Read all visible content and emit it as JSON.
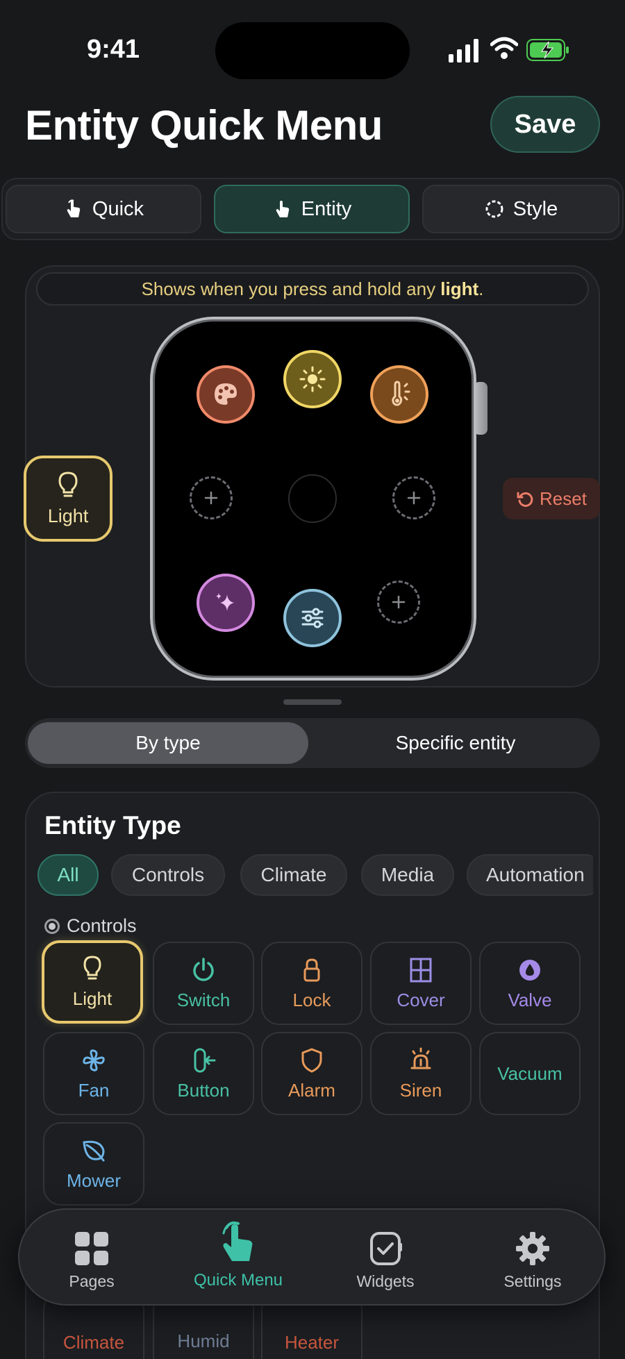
{
  "status": {
    "time": "9:41"
  },
  "header": {
    "title": "Entity Quick Menu",
    "save_label": "Save"
  },
  "tabs": [
    {
      "label": "Quick",
      "icon": "hand-tap-icon"
    },
    {
      "label": "Entity",
      "icon": "hand-pointer-icon",
      "active": true
    },
    {
      "label": "Style",
      "icon": "dashed-circle-icon"
    }
  ],
  "preview": {
    "hint_prefix": "Shows when you press and hold any ",
    "hint_bold": "light",
    "hint_suffix": ".",
    "selected_chip": "Light",
    "reset_label": "Reset",
    "slots": [
      "palette-icon",
      "brightness-icon",
      "color-temperature-icon",
      "add-slot",
      "center",
      "add-slot",
      "effects-sparkle-icon",
      "sliders-icon",
      "add-slot"
    ]
  },
  "mode": {
    "options": [
      "By type",
      "Specific entity"
    ],
    "selected": "By type"
  },
  "entity_type": {
    "title": "Entity Type",
    "filters": [
      "All",
      "Controls",
      "Climate",
      "Media",
      "Automation"
    ],
    "active_filter": "All",
    "group_label": "Controls",
    "items": [
      {
        "label": "Light",
        "icon": "bulb-icon",
        "color": "#f2e2a8",
        "selected": true
      },
      {
        "label": "Switch",
        "icon": "power-icon",
        "color": "#48c1a4"
      },
      {
        "label": "Lock",
        "icon": "lock-icon",
        "color": "#e89a5a"
      },
      {
        "label": "Cover",
        "icon": "window-icon",
        "color": "#9b8ee6"
      },
      {
        "label": "Valve",
        "icon": "drop-icon",
        "color": "#a58ae8"
      },
      {
        "label": "Fan",
        "icon": "fan-icon",
        "color": "#6db4e8"
      },
      {
        "label": "Button",
        "icon": "button-press-icon",
        "color": "#48c1a4"
      },
      {
        "label": "Alarm",
        "icon": "shield-icon",
        "color": "#e89a5a"
      },
      {
        "label": "Siren",
        "icon": "siren-icon",
        "color": "#e89a5a"
      },
      {
        "label": "Vacuum",
        "icon": "",
        "color": "#48c1a4"
      },
      {
        "label": "Mower",
        "icon": "leaf-icon",
        "color": "#6db4e8"
      }
    ],
    "peek_items": [
      {
        "label": "Climate",
        "color": "#c8563f"
      },
      {
        "label": "Humid",
        "color": "#6f7d96"
      },
      {
        "label": "Heater",
        "color": "#c8563f"
      }
    ]
  },
  "nav": [
    {
      "label": "Pages",
      "icon": "grid-icon"
    },
    {
      "label": "Quick Menu",
      "icon": "hand-tap-icon",
      "active": true
    },
    {
      "label": "Widgets",
      "icon": "watch-check-icon"
    },
    {
      "label": "Settings",
      "icon": "gear-icon"
    }
  ],
  "colors": {
    "accent": "#3fc1a8",
    "light_yellow": "#e6c86e",
    "reset_red": "#ec7d6a"
  }
}
